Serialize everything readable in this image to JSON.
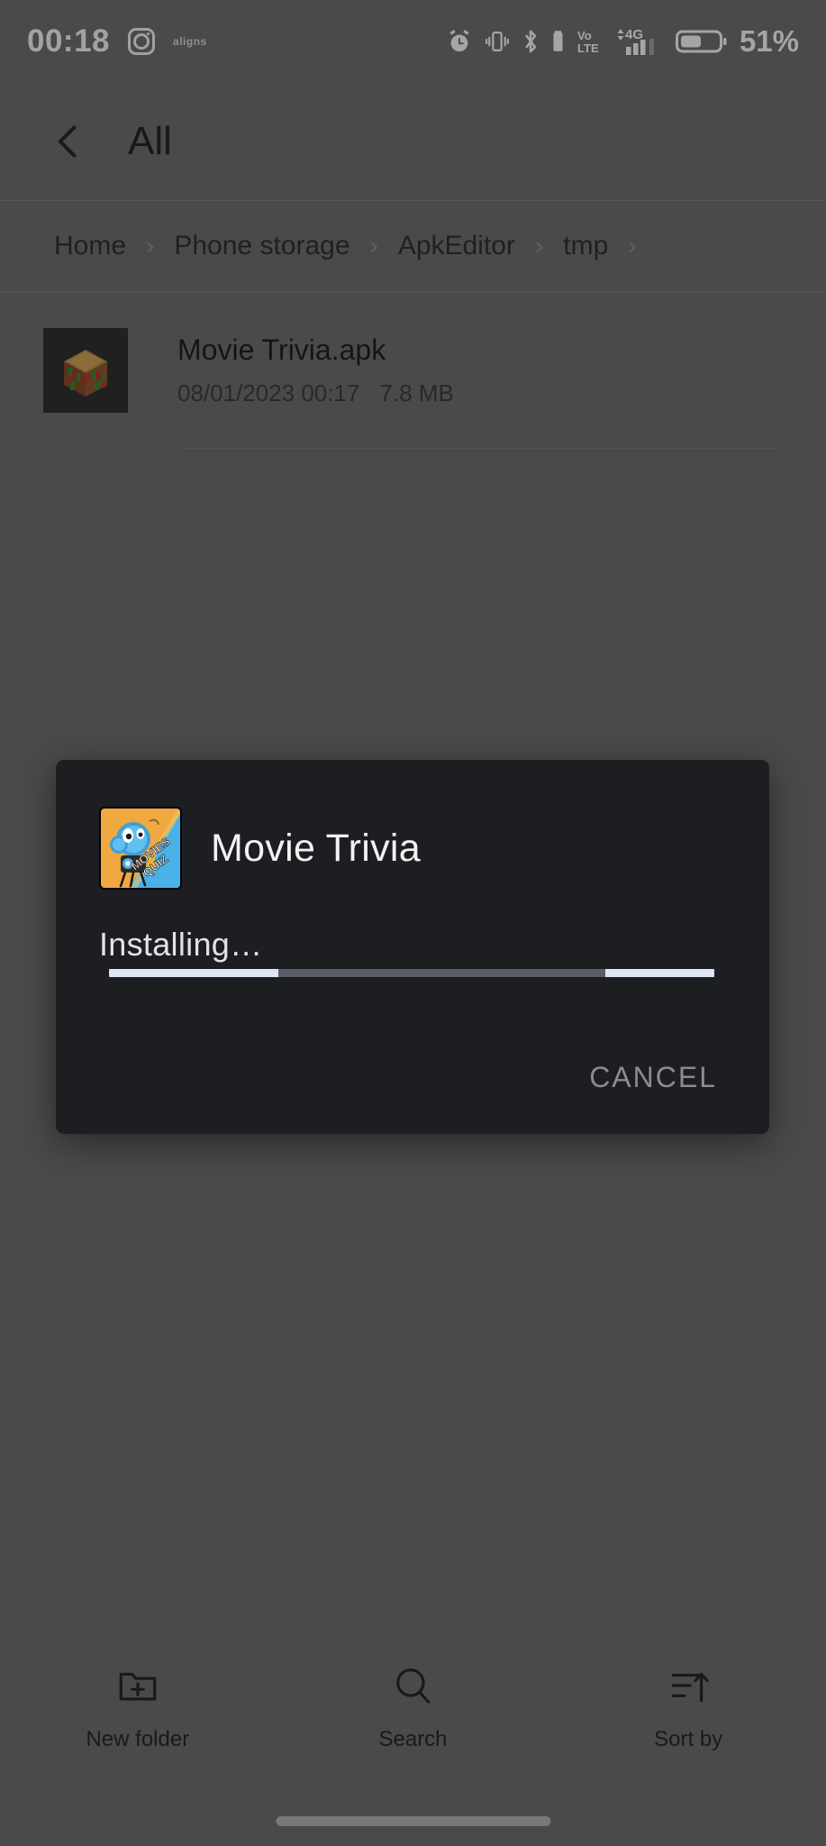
{
  "status_bar": {
    "time": "00:18",
    "brand_text": "aligns",
    "battery_percent": "51%",
    "icons": [
      "instagram-icon",
      "alarm-icon",
      "vibrate-icon",
      "bluetooth-icon",
      "bluetooth-battery-icon",
      "volte-icon",
      "signal-4g-icon",
      "battery-icon"
    ],
    "network_label": "4G",
    "volte_top": "Vo",
    "volte_bottom": "LTE"
  },
  "app_bar": {
    "back_icon": "chevron-left-icon",
    "title": "All"
  },
  "breadcrumb": {
    "separator": "›",
    "items": [
      "Home",
      "Phone storage",
      "ApkEditor",
      "tmp"
    ]
  },
  "file_list": {
    "items": [
      {
        "name": "Movie Trivia.apk",
        "date": "08/01/2023 00:17",
        "size": "7.8 MB",
        "thumbnail": "apk-crate-icon"
      }
    ]
  },
  "toolbar": {
    "items": [
      {
        "label": "New folder",
        "icon": "new-folder-icon"
      },
      {
        "label": "Search",
        "icon": "search-icon"
      },
      {
        "label": "Sort by",
        "icon": "sort-by-icon"
      }
    ]
  },
  "dialog": {
    "app_icon": "movies-quiz-app-icon",
    "app_icon_text_line1": "MOVIES",
    "app_icon_text_line2": "QUIZ",
    "title": "Movie Trivia",
    "status": "Installing…",
    "cancel_label": "CANCEL",
    "progress": {
      "indeterminate": true,
      "segments": [
        {
          "left_pct": 0,
          "width_pct": 28
        },
        {
          "left_pct": 82,
          "width_pct": 18
        }
      ],
      "track_color": "#5b5e66",
      "bar_color": "#dfe5f7"
    }
  },
  "colors": {
    "page_background": "#6a6a6a",
    "dialog_background": "#1d1e22",
    "scrim": "rgba(0,0,0,0.30)",
    "text_primary": "#1f1f1f",
    "dialog_text": "#f2f2f2",
    "cancel_text": "#8b8b90"
  }
}
